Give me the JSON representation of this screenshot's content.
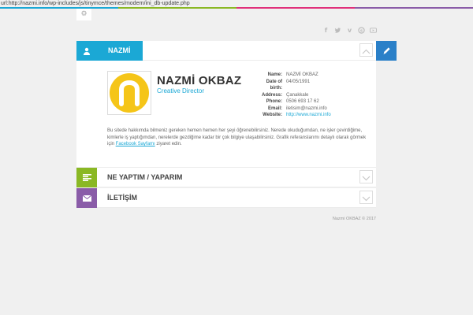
{
  "url_bar": {
    "text": "url:http://nazmi.info/wp-includes/js/tinymce/themes/modern/ini_db-update.php"
  },
  "color_strip": [
    "#1ba8d5",
    "#8ab824",
    "#e0307a",
    "#8a5ca8"
  ],
  "top": {
    "settings_icon": "gear-icon"
  },
  "social": [
    "facebook-icon",
    "twitter-icon",
    "vimeo-icon",
    "skype-icon",
    "youtube-icon"
  ],
  "sections": {
    "about": {
      "title": "NAZMİ",
      "color": "#1ba8d5",
      "icon": "user-icon"
    },
    "work": {
      "title": "NE YAPTIM / YAPARIM",
      "color": "#8ab824",
      "icon": "list-icon"
    },
    "contact": {
      "title": "İLETİŞİM",
      "color": "#8a5ca8",
      "icon": "envelope-icon"
    }
  },
  "profile": {
    "name": "NAZMİ OKBAZ",
    "role": "Creative Director",
    "avatar_letter": "n",
    "info": [
      {
        "key": "Name:",
        "value": "NAZMİ OKBAZ"
      },
      {
        "key": "Date of",
        "value": "04/05/1991"
      },
      {
        "key": "birth:",
        "value": ""
      },
      {
        "key": "Address:",
        "value": "Çanakkale"
      },
      {
        "key": "Phone:",
        "value": "0506 693 17 62"
      },
      {
        "key": "Email:",
        "value": "iletisim@nazmi.info"
      },
      {
        "key": "Website:",
        "value": "http://www.nazmi.info"
      }
    ],
    "bio_text": "Bu sitede hakkımda bilmeniz gereken hemen hemen her şeyi öğrenebilirsiniz. Nerede okuduğumdan, ne işler çevirdiğime, kimlerle iş yaptığımdan, nerelerde gezdiğime kadar bir çok bilgiye ulaşabilirsiniz. Grafik referanslarımı detaylı olarak görmek için ",
    "bio_link": "Facebook Sayfamı",
    "bio_end": " ziyaret edin."
  },
  "footer": {
    "text": "Nazmi OKBAZ © 2017"
  }
}
